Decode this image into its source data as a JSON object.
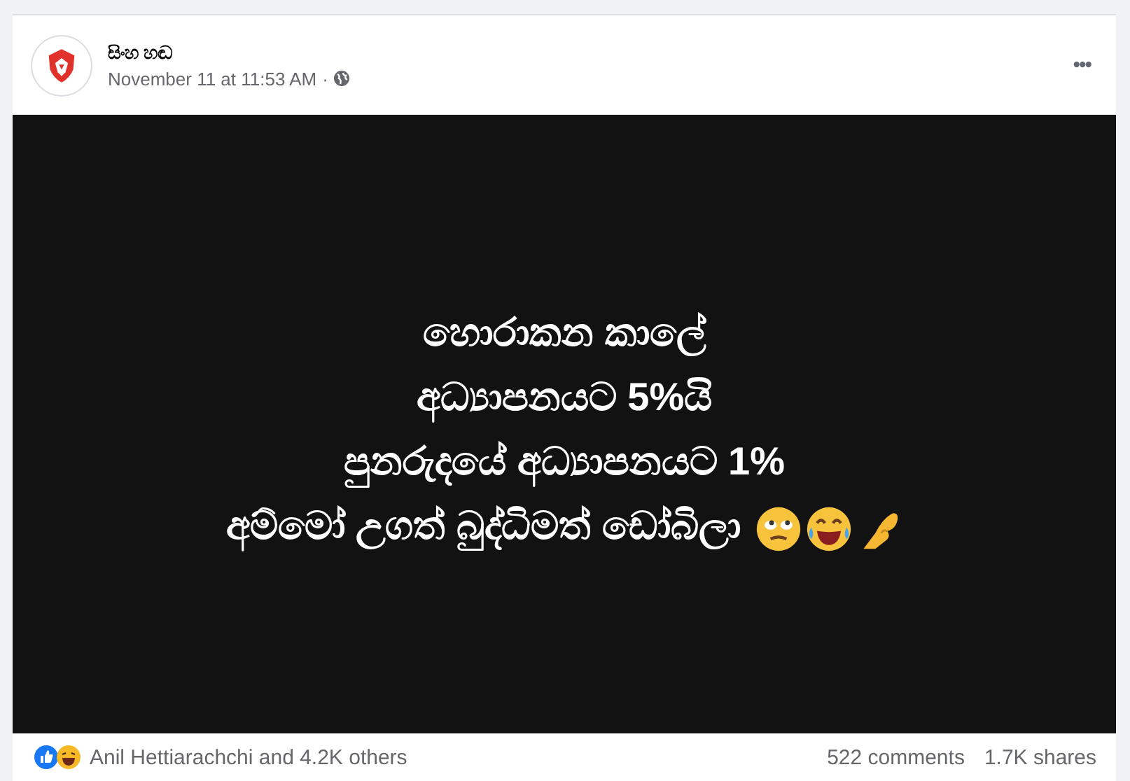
{
  "post": {
    "author": "සිංහ හඬ",
    "timestamp": "November 11 at 11:53 AM",
    "separator": "·",
    "menu": "•••"
  },
  "image_lines": [
    "හොරාකන කාලේ",
    "අධ්‍යාපනයට **5%**යි",
    "පුනරුදයේ අධ්‍යාපනයට **1%**",
    "අම්මෝ උගත් බුද්ධිමත් ඩෝබිලා"
  ],
  "image_emojis": [
    {
      "kind": "eyeroll"
    },
    {
      "kind": "laughing"
    },
    {
      "kind": "pinch"
    }
  ],
  "footer": {
    "reactions": [
      {
        "kind": "like"
      },
      {
        "kind": "haha"
      }
    ],
    "reactors": "Anil Hettiarachchi and 4.2K others",
    "comments": "522 comments",
    "shares": "1.7K shares"
  }
}
